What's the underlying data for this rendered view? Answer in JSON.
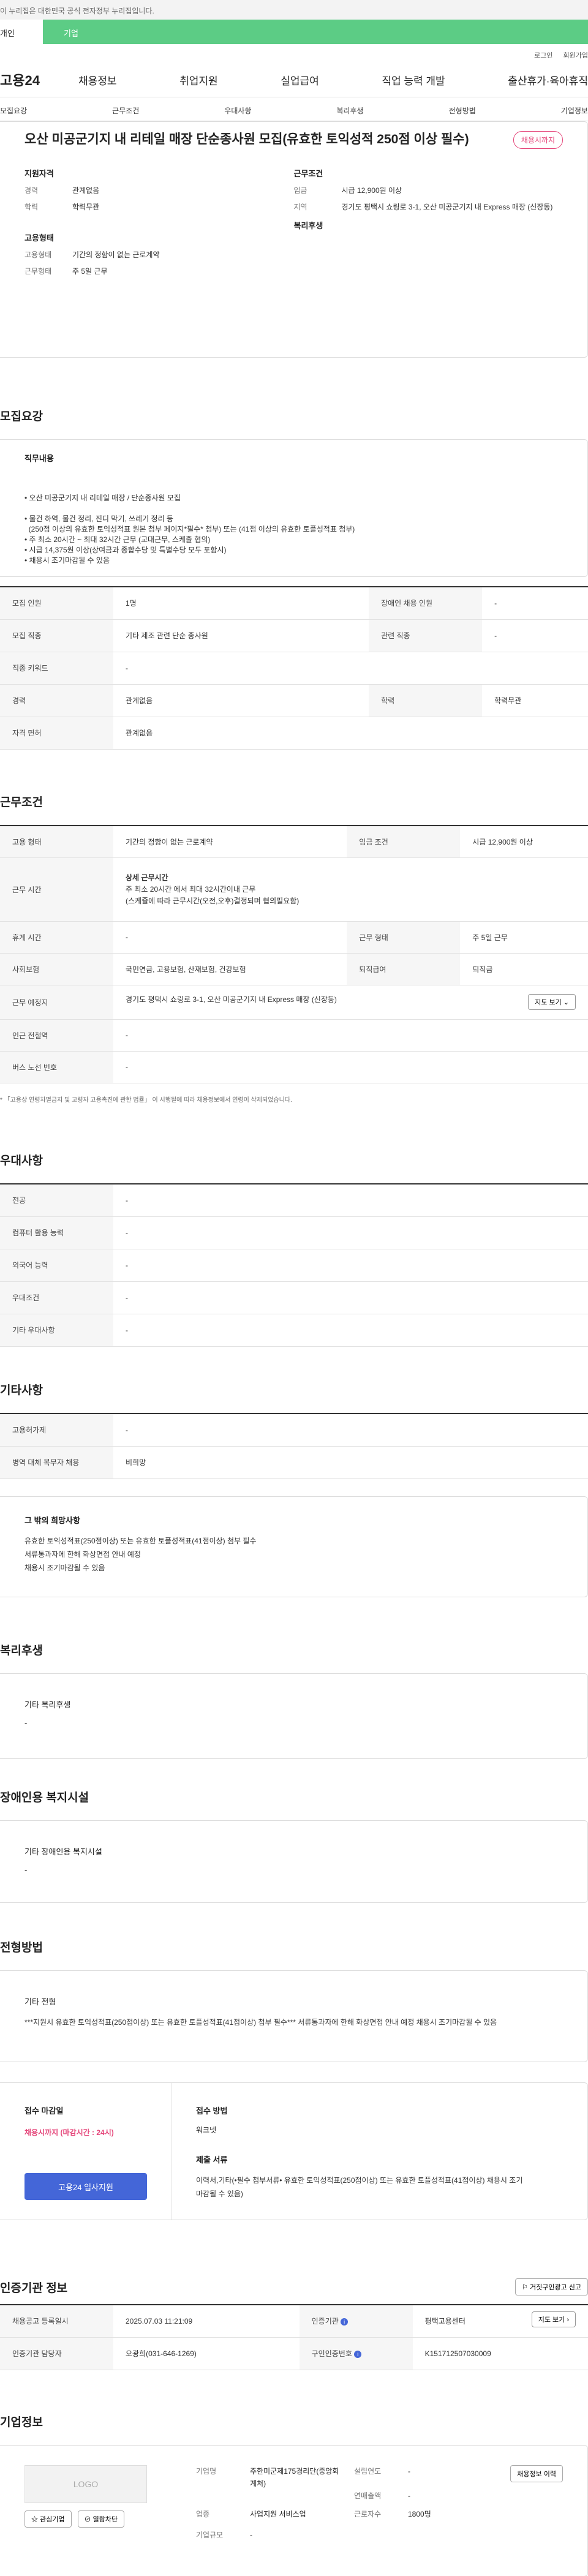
{
  "gov_banner": "이 누리집은 대한민국 공식 전자정부 누리집입니다.",
  "tabs": {
    "individual": "개인",
    "company": "기업"
  },
  "util": {
    "login": "로그인",
    "signup": "회원가입"
  },
  "gnb": {
    "logo": "고용24",
    "menu": [
      "채용정보",
      "취업지원",
      "실업급여",
      "직업 능력 개발",
      "출산휴가·육아휴직"
    ]
  },
  "subnav": [
    "모집요강",
    "근무조건",
    "우대사항",
    "복리후생",
    "전형방법",
    "기업정보"
  ],
  "summary": {
    "title": "오산 미공군기지 내 리테일 매장 단순종사원 모집(유효한 토익성적 250점 이상 필수)",
    "badge": "채용시까지",
    "qual_title": "지원자격",
    "career_k": "경력",
    "career_v": "관계없음",
    "edu_k": "학력",
    "edu_v": "학력무관",
    "cond_title": "근무조건",
    "wage_k": "임금",
    "wage_v": "시급 12,900원 이상",
    "loc_k": "지역",
    "loc_v": "경기도 평택시 쇼링로 3-1, 오산 미공군기지 내 Express 매장 (신장동)",
    "emp_title": "고용형태",
    "emptype_k": "고용형태",
    "emptype_v": "기간의 정함이 없는 근로계약",
    "worktype_k": "근무형태",
    "worktype_v": "주 5일 근무",
    "welfare_title": "복리후생"
  },
  "recruit": {
    "title": "모집요강",
    "duty_title": "직무내용",
    "duty_lines": [
      "• 오산 미공군기지 내 리테일 매장 / 단순종사원 모집",
      "",
      "• 물건 하역, 물건 정리, 진디 막기, 쓰레기 정리 등",
      "  (250점 이상의 유효한 토익성적표 원본 첨부 페이지*필수* 첨부) 또는 (41점 이상의 유효한 토플성적표 첨부)",
      "• 주 최소 20시간 ~ 최대 32시간 근무 (교대근무, 스케줄 협의)",
      "• 시급 14,375원 이상(상여금과 종합수당 및 특별수당 모두 포함시)",
      "• 채용시 조기마감될 수 있음"
    ],
    "rows": [
      {
        "h1": "모집 인원",
        "v1": "1명",
        "h2": "장애인 채용 인원",
        "v2": "-"
      },
      {
        "h1": "모집 직종",
        "v1": "기타 제조 관련 단순 종사원",
        "h2": "관련 직종",
        "v2": "-"
      },
      {
        "h1": "직종 키워드",
        "v1": "-"
      },
      {
        "h1": "경력",
        "v1": "관계없음",
        "h2": "학력",
        "v2": "학력무관"
      },
      {
        "h1": "자격 면허",
        "v1": "관계없음"
      }
    ]
  },
  "work": {
    "title": "근무조건",
    "emp_h": "고용 형태",
    "emp_v": "기간의 정함이 없는 근로계약",
    "wage_h": "임금 조건",
    "wage_v": "시급 12,900원 이상",
    "time_h": "근무 시간",
    "time_title": "상세 근무시간",
    "time_l1": "주 최소 20시간 에서 최대 32시간이내 근무",
    "time_l2": "(스케쥴에 따라 근무시간(오전,오후)결정되며 협의필요함)",
    "rest_h": "휴게 시간",
    "rest_v": "-",
    "form_h": "근무 형태",
    "form_v": "주 5일 근무",
    "ins_h": "사회보험",
    "ins_v": "국민연금, 고용보험, 산재보험, 건강보험",
    "sev_h": "퇴직급여",
    "sev_v": "퇴직금",
    "place_h": "근무 예정지",
    "place_v": "경기도 평택시 쇼링로 3-1, 오산 미공군기지 내 Express 매장 (신장동)",
    "map_btn": "지도 보기",
    "subway_h": "인근 전철역",
    "subway_v": "-",
    "bus_h": "버스 노선 번호",
    "bus_v": "-",
    "note": "* 「고용상 연령차별금지 및 고령자 고용촉진에 관한 법률」 이 시행될에 따라 채용정보에서 연령이 삭제되었습니다."
  },
  "pref": {
    "title": "우대사항",
    "rows": [
      {
        "h": "전공",
        "v": "-"
      },
      {
        "h": "컴퓨터 활용 능력",
        "v": "-"
      },
      {
        "h": "외국어 능력",
        "v": "-"
      },
      {
        "h": "우대조건",
        "v": "-"
      },
      {
        "h": "기타 우대사항",
        "v": "-"
      }
    ]
  },
  "etc": {
    "title": "기타사항",
    "rows": [
      {
        "h": "고용허가제",
        "v": "-"
      },
      {
        "h": "병역 대체 복무자 채용",
        "v": "비희망"
      }
    ],
    "other_title": "그 밖의 희망사항",
    "other_lines": [
      "유효한 토익성적표(250점이상) 또는 유효한 토플성적표(41점이상) 첨부 필수",
      "서류통과자에 한해 화상면접 안내 예정",
      "채용시 조기마감될 수 있음"
    ]
  },
  "welfare": {
    "title": "복리후생",
    "sub": "기타 복리후생",
    "value": "-"
  },
  "disabled": {
    "title": "장애인용 복지시설",
    "sub": "기타 장애인용 복지시설",
    "value": "-"
  },
  "selection": {
    "title": "전형방법",
    "sub": "기타 전형",
    "text": "***지원시 유효한 토익성적표(250점이상) 또는 유효한 토플성적표(41점이상) 첨부 필수*** 서류통과자에 한해 화상면접 안내 예정 채용시 조기마감될 수 있음"
  },
  "apply": {
    "deadline_title": "접수 마감일",
    "deadline_v": "채용시까지 (마감시간 : 24시)",
    "apply_btn": "고용24 입사지원",
    "method_title": "접수 방법",
    "method_v": "워크넷",
    "docs_title": "제출 서류",
    "docs_v": "이력서,기타(•필수 첨부서류• 유효한 토익성적표(250점이상) 또는 유효한 토플성적표(41점이상) 채용시 조기마감될 수 있음)"
  },
  "cert": {
    "title": "인증기관 정보",
    "report_btn": "거짓구인광고 신고",
    "reg_h": "채용공고 등록일시",
    "reg_v": "2025.07.03 11:21:09",
    "agency_h": "인증기관",
    "agency_v": "평택고용센터",
    "manager_h": "인증기관 담당자",
    "manager_v": "오광희(031-646-1269)",
    "num_h": "구인인증번호",
    "num_v": "K151712507030009",
    "map_btn": "지도 보기"
  },
  "company": {
    "title": "기업정보",
    "logo": "LOGO",
    "fav_btn": "관심기업",
    "block_btn": "열람차단",
    "name_k": "기업명",
    "name_v": "주한미군제175경리단(중앙회계처)",
    "year_k": "설립연도",
    "year_v": "-",
    "sales_k": "연매출액",
    "sales_v": "-",
    "ind_k": "업종",
    "ind_v": "사업지원 서비스업",
    "emp_k": "근로자수",
    "emp_v": "1800명",
    "size_k": "기업규모",
    "size_v": "-",
    "history_btn": "채용정보 이력"
  },
  "colors": {
    "green": "#5ccc85",
    "blue": "#4466d8",
    "red": "#e5467a"
  }
}
